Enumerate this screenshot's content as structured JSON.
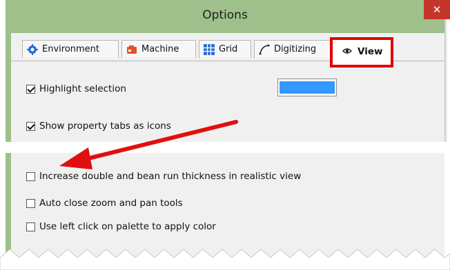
{
  "window": {
    "title": "Options",
    "close_icon": "close-icon"
  },
  "tabs": [
    {
      "label": "Environment",
      "icon": "gear-icon"
    },
    {
      "label": "Machine",
      "icon": "machine-icon"
    },
    {
      "label": "Grid",
      "icon": "grid-icon"
    },
    {
      "label": "Digitizing",
      "icon": "curve-icon"
    },
    {
      "label": "View",
      "icon": "eye-icon",
      "active": true
    }
  ],
  "options": {
    "highlight_selection": {
      "label": "Highlight selection",
      "checked": true,
      "color": "#3399ff"
    },
    "show_property_tabs": {
      "label": "Show property tabs as icons",
      "checked": true
    },
    "increase_thickness": {
      "label": "Increase double and bean run thickness in realistic view",
      "checked": false
    },
    "auto_close_zoom": {
      "label": "Auto close zoom and pan tools",
      "checked": false
    },
    "left_click_palette": {
      "label": "Use left click on palette to apply color",
      "checked": false
    }
  },
  "accents": {
    "highlight_frame": "#e00000",
    "arrow": "#e01010",
    "window_chrome": "#9fc08a"
  }
}
